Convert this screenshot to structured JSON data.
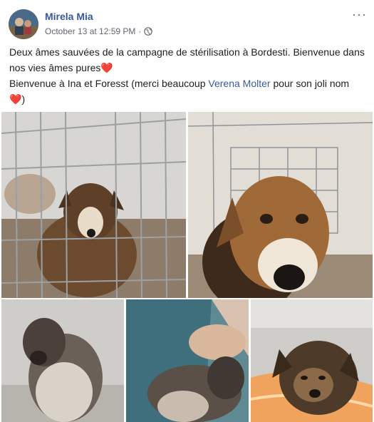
{
  "post": {
    "author": "Mirela Mia",
    "timestamp": "October 13 at 12:59 PM",
    "separator": "·",
    "more": "···",
    "text": {
      "line1": "Deux âmes sauvées de la campagne de stérilisation à Bordesti. Bienvenue dans nos vies âmes pures",
      "line1_emoji": "❤️",
      "line2_prefix": "Bienvenue à Ina et Foresst (merci beaucoup ",
      "mention": "Verena Molter",
      "line2_suffix": " pour son joli nom ",
      "line2_emoji": "❤️",
      "line2_close": ")"
    }
  },
  "photos": [
    {
      "id": "photo-1",
      "subject": "puppy in metal cage"
    },
    {
      "id": "photo-2",
      "subject": "puppy close-up face"
    },
    {
      "id": "photo-3",
      "subject": "fluffy puppy from above"
    },
    {
      "id": "photo-4",
      "subject": "puppy held by person"
    },
    {
      "id": "photo-5",
      "subject": "puppy on orange blanket"
    }
  ],
  "colors": {
    "link": "#385898",
    "text": "#1c1e21",
    "meta": "#616770",
    "heart": "#e0245e"
  },
  "icons": [
    "globe-icon",
    "more-options-icon"
  ]
}
